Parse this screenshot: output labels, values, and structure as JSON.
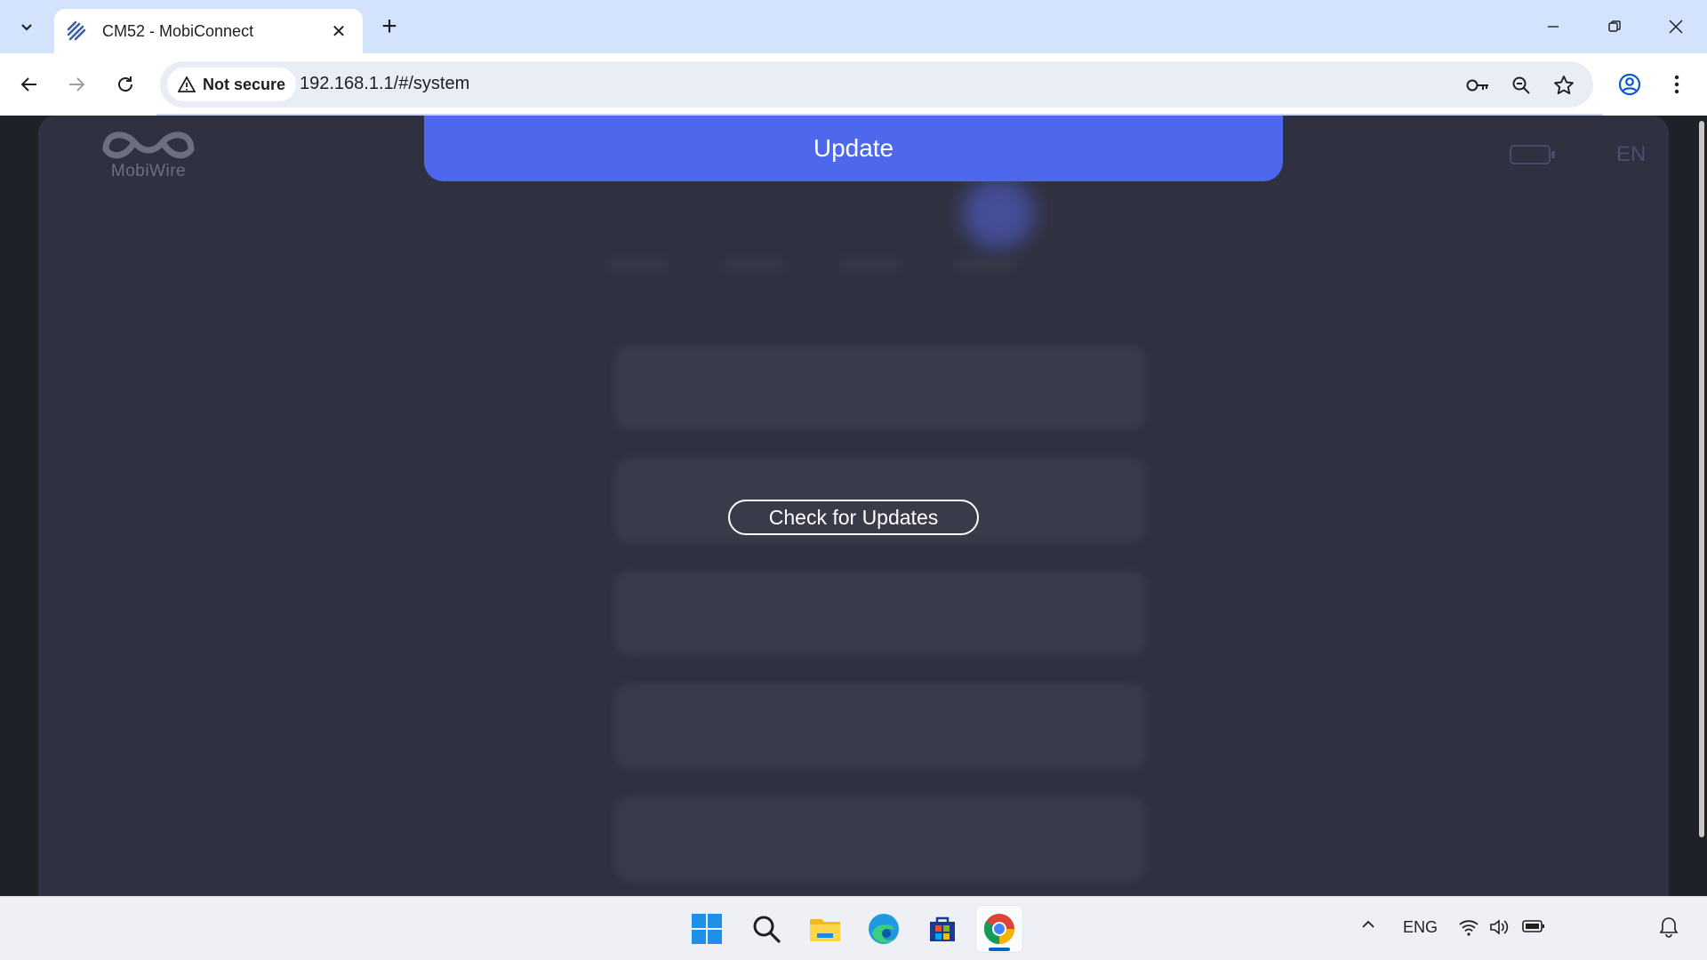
{
  "browser": {
    "tab_title": "CM52 - MobiConnect",
    "security_label": "Not secure",
    "url": "192.168.1.1/#/system",
    "new_tab_symbol": "+",
    "close_symbol": "✕"
  },
  "app": {
    "logo_text": "MobiWire",
    "language": "EN",
    "banner_title": "Update",
    "check_button_label": "Check for Updates",
    "blurred_items": [
      "",
      "",
      "",
      "",
      ""
    ]
  },
  "taskbar": {
    "language": "ENG",
    "apps": [
      "windows-start-icon",
      "search-icon",
      "file-explorer-icon",
      "edge-icon",
      "microsoft-store-icon",
      "chrome-icon"
    ]
  },
  "colors": {
    "accent": "#4d68ec",
    "page_bg": "#303140",
    "tabbar_bg": "#d3e3fd"
  }
}
